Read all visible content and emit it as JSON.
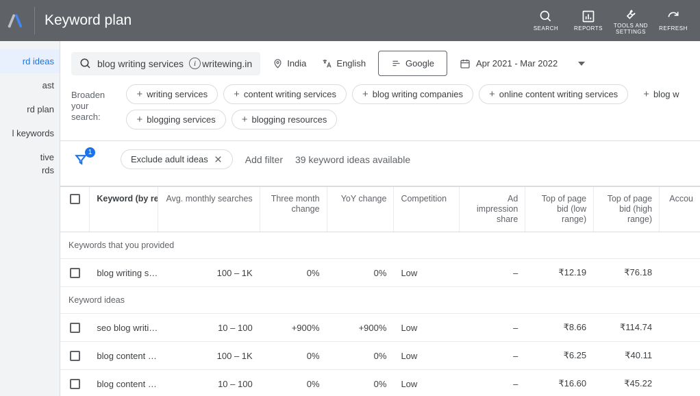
{
  "header": {
    "title": "Keyword plan",
    "actions": {
      "search": "SEARCH",
      "reports": "REPORTS",
      "tools": "TOOLS AND SETTINGS",
      "refresh": "REFRESH"
    }
  },
  "sidebar": {
    "items": [
      {
        "label": "rd ideas"
      },
      {
        "label": "ast"
      },
      {
        "label": "rd plan"
      },
      {
        "label": "l keywords"
      },
      {
        "label": "tive"
      },
      {
        "label": "rds"
      }
    ]
  },
  "search": {
    "query": "blog writing services",
    "site": "writewing.in",
    "location": "India",
    "language": "English",
    "network": "Google",
    "daterange": "Apr 2021 - Mar 2022"
  },
  "broaden": {
    "label": "Broaden your search:",
    "chips": [
      "writing services",
      "content writing services",
      "blog writing companies",
      "online content writing services",
      "blog w",
      "blogging services",
      "blogging resources"
    ]
  },
  "filters": {
    "badge": "1",
    "excluded": "Exclude adult ideas",
    "add": "Add filter",
    "count": "39 keyword ideas available"
  },
  "table": {
    "headers": {
      "keyword": "Keyword (by relevance)",
      "avg": "Avg. monthly searches",
      "three_month": "Three month change",
      "yoy": "YoY change",
      "competition": "Competition",
      "ad_share": "Ad impression share",
      "bid_low": "Top of page bid (low range)",
      "bid_high": "Top of page bid (high range)",
      "account": "Accou"
    },
    "sections": {
      "provided": "Keywords that you provided",
      "ideas": "Keyword ideas"
    },
    "rows_provided": [
      {
        "kw": "blog writing s…",
        "avg": "100 – 1K",
        "tm": "0%",
        "yoy": "0%",
        "comp": "Low",
        "imp": "–",
        "low": "₹12.19",
        "high": "₹76.18"
      }
    ],
    "rows_ideas": [
      {
        "kw": "seo blog writi…",
        "avg": "10 – 100",
        "tm": "+900%",
        "yoy": "+900%",
        "comp": "Low",
        "imp": "–",
        "low": "₹8.66",
        "high": "₹114.74"
      },
      {
        "kw": "blog content …",
        "avg": "100 – 1K",
        "tm": "0%",
        "yoy": "0%",
        "comp": "Low",
        "imp": "–",
        "low": "₹6.25",
        "high": "₹40.11"
      },
      {
        "kw": "blog content …",
        "avg": "10 – 100",
        "tm": "0%",
        "yoy": "0%",
        "comp": "Low",
        "imp": "–",
        "low": "₹16.60",
        "high": "₹45.22"
      }
    ]
  }
}
